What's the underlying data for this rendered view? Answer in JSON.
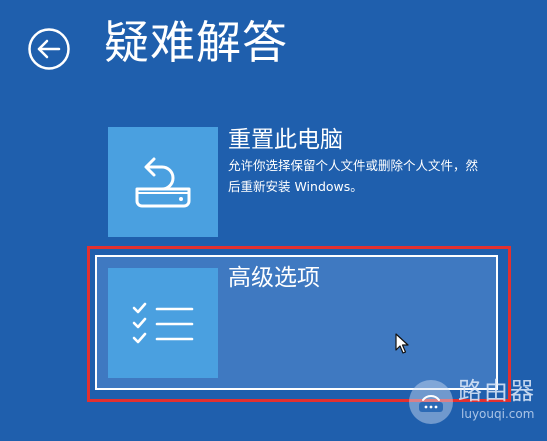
{
  "header": {
    "back_icon": "back-arrow-circle-icon",
    "title": "疑难解答"
  },
  "options": [
    {
      "icon": "reset-pc-icon",
      "title": "重置此电脑",
      "description": "允许你选择保留个人文件或删除个人文件，然后重新安装 Windows。"
    },
    {
      "icon": "checklist-icon",
      "title": "高级选项",
      "description": ""
    }
  ],
  "watermark": {
    "icon": "router-logo-icon",
    "name": "路由器",
    "url": "luyouqi.com"
  },
  "colors": {
    "background": "#1f5fad",
    "tile": "#4aa0e0",
    "selected": "#3f79c1",
    "annotation": "#e3302f"
  }
}
